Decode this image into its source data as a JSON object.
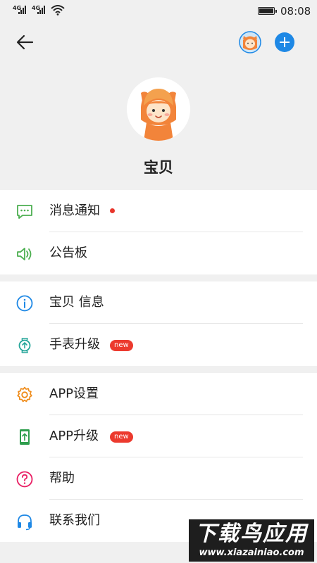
{
  "status_bar": {
    "network_1": "4G",
    "network_2": "4G",
    "time": "08:08"
  },
  "header": {
    "back_icon": "arrow-left-icon",
    "avatar_icon": "child-avatar-icon",
    "add_icon": "plus-circle-icon"
  },
  "profile": {
    "name": "宝贝"
  },
  "menu": {
    "group1": [
      {
        "label": "消息通知",
        "icon": "message-icon",
        "color": "#4caf50",
        "unread_dot": true
      },
      {
        "label": "公告板",
        "icon": "speaker-icon",
        "color": "#4caf50"
      }
    ],
    "group2": [
      {
        "label": "宝贝 信息",
        "icon": "info-icon",
        "color": "#1e88e5"
      },
      {
        "label": "手表升级",
        "icon": "watch-upgrade-icon",
        "color": "#26a69a",
        "badge": "new"
      }
    ],
    "group3": [
      {
        "label": "APP设置",
        "icon": "gear-icon",
        "color": "#ef8a17"
      },
      {
        "label": "APP升级",
        "icon": "phone-upgrade-icon",
        "color": "#2e9e4d",
        "badge": "new"
      },
      {
        "label": "帮助",
        "icon": "help-icon",
        "color": "#e91e63"
      },
      {
        "label": "联系我们",
        "icon": "headset-icon",
        "color": "#1e88e5"
      }
    ]
  },
  "watermark": {
    "title": "下载鸟应用",
    "url": "www.xiazainiao.com"
  },
  "colors": {
    "accent_blue": "#1e88e5",
    "badge_red": "#ec3a2e",
    "background": "#f0f0f0"
  }
}
